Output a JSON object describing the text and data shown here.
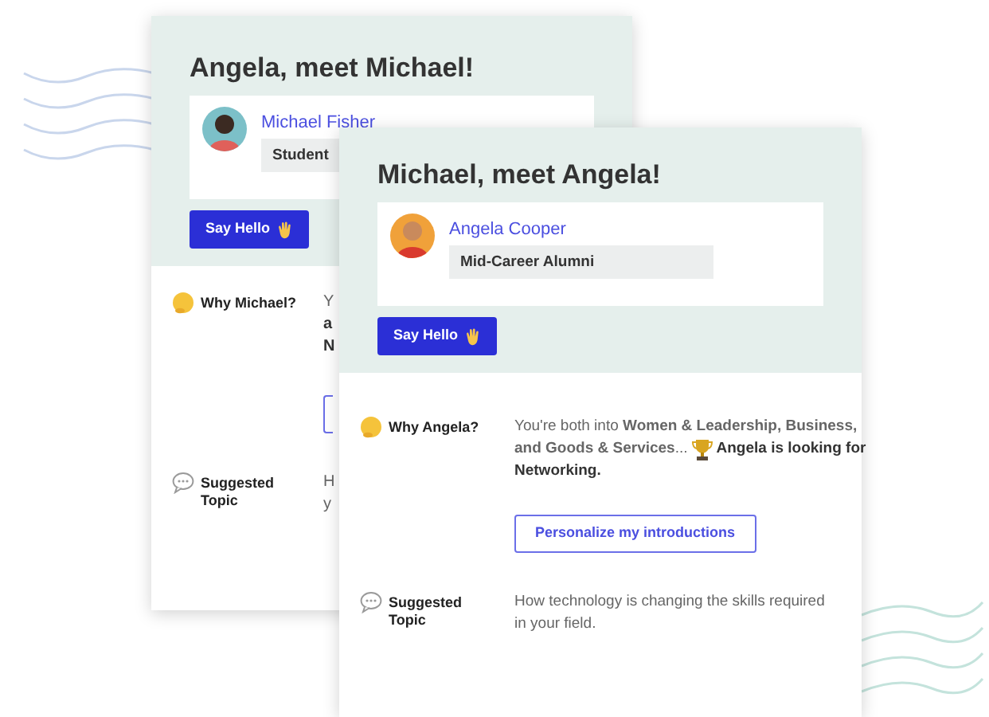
{
  "back_card": {
    "title": "Angela, meet Michael!",
    "person": {
      "name": "Michael Fisher",
      "tag": "Student"
    },
    "button": "Say Hello",
    "why": {
      "label": "Why Michael?",
      "fragments": [
        {
          "text": "Y",
          "bold": false
        },
        {
          "text": "a",
          "bold": true
        },
        {
          "text": "N",
          "bold": true
        }
      ]
    },
    "topic": {
      "label": "Suggested Topic",
      "fragments": [
        {
          "text": "H",
          "bold": false
        },
        {
          "text": "y",
          "bold": false
        }
      ]
    }
  },
  "front_card": {
    "title": "Michael, meet Angela!",
    "person": {
      "name": "Angela Cooper",
      "tag": "Mid-Career Alumni"
    },
    "button": "Say Hello",
    "why": {
      "label": "Why Angela?",
      "text_lines": [
        "You're both into **Women & Leadership, Business,**",
        "**and Goods & Services**..."
      ],
      "highlight_lines": [
        "Angela is looking for",
        "Networking."
      ]
    },
    "action": "Personalize my introductions",
    "topic": {
      "label": "Suggested Topic",
      "text": "How technology is changing the skills required in your field."
    }
  }
}
